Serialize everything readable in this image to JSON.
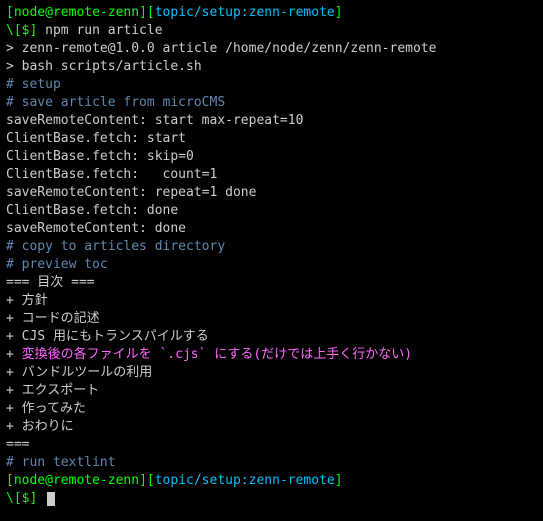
{
  "prompt1": {
    "lbracket1": "[",
    "userhost": "node@remote-zenn",
    "rbracket1": "]",
    "lbracket2": "[",
    "branch": "topic/setup:zenn-remote",
    "rbracket2": "]",
    "ps": "\\[$] ",
    "command": "npm run article"
  },
  "output": {
    "blank1": "",
    "l1": "> zenn-remote@1.0.0 article /home/node/zenn/zenn-remote",
    "l2": "> bash scripts/article.sh",
    "blank2": "",
    "l3": "# setup",
    "l4": "# save article from microCMS",
    "l5": "saveRemoteContent: start max-repeat=10",
    "l6": "ClientBase.fetch: start",
    "l7": "ClientBase.fetch: skip=0",
    "l8": "ClientBase.fetch:   count=1",
    "l9": "saveRemoteContent: repeat=1 done",
    "l10": "ClientBase.fetch: done",
    "l11": "saveRemoteContent: done",
    "l12": "# copy to articles directory",
    "l13": "# preview toc",
    "l14": "=== 目次 ===",
    "l15": "+ 方針",
    "l16": "+ コードの記述",
    "l17": "+ CJS 用にもトランスパイルする",
    "l18_plus": "+ ",
    "l18_text": "変換後の各ファイルを `.cjs` にする(だけでは上手く行かない)",
    "l19": "+ バンドルツールの利用",
    "l20": "+ エクスポート",
    "l21": "+ 作ってみた",
    "l22": "+ おわりに",
    "l23": "===",
    "l24": "# run textlint"
  },
  "prompt2": {
    "lbracket1": "[",
    "userhost": "node@remote-zenn",
    "rbracket1": "]",
    "lbracket2": "[",
    "branch": "topic/setup:zenn-remote",
    "rbracket2": "]",
    "ps": "\\[$] "
  }
}
